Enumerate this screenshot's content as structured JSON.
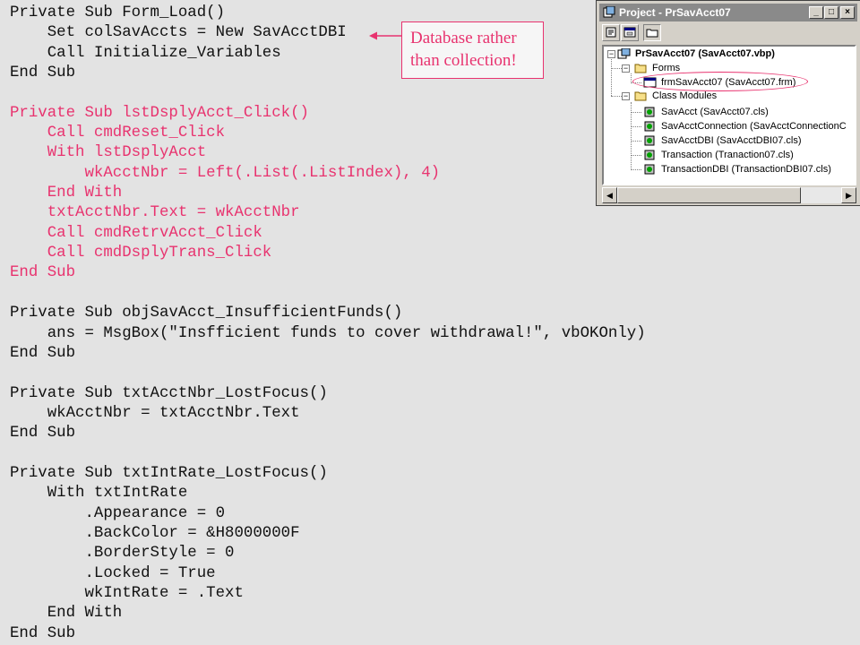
{
  "code_lines": [
    {
      "text": "Private Sub Form_Load()",
      "color": "#111111"
    },
    {
      "text": "    Set colSavAccts = New SavAcctDBI",
      "color": "#111111"
    },
    {
      "text": "    Call Initialize_Variables",
      "color": "#111111"
    },
    {
      "text": "End Sub",
      "color": "#111111"
    },
    {
      "text": "",
      "color": "#111111"
    },
    {
      "text": "Private Sub lstDsplyAcct_Click()",
      "color": "#e8336f"
    },
    {
      "text": "    Call cmdReset_Click",
      "color": "#e8336f"
    },
    {
      "text": "    With lstDsplyAcct",
      "color": "#e8336f"
    },
    {
      "text": "        wkAcctNbr = Left(.List(.ListIndex), 4)",
      "color": "#e8336f"
    },
    {
      "text": "    End With",
      "color": "#e8336f"
    },
    {
      "text": "    txtAcctNbr.Text = wkAcctNbr",
      "color": "#e8336f"
    },
    {
      "text": "    Call cmdRetrvAcct_Click",
      "color": "#e8336f"
    },
    {
      "text": "    Call cmdDsplyTrans_Click",
      "color": "#e8336f"
    },
    {
      "text": "End Sub",
      "color": "#e8336f"
    },
    {
      "text": "",
      "color": "#111111"
    },
    {
      "text": "Private Sub objSavAcct_InsufficientFunds()",
      "color": "#111111"
    },
    {
      "text": "    ans = MsgBox(\"Insfficient funds to cover withdrawal!\", vbOKOnly)",
      "color": "#111111"
    },
    {
      "text": "End Sub",
      "color": "#111111"
    },
    {
      "text": "",
      "color": "#111111"
    },
    {
      "text": "Private Sub txtAcctNbr_LostFocus()",
      "color": "#111111"
    },
    {
      "text": "    wkAcctNbr = txtAcctNbr.Text",
      "color": "#111111"
    },
    {
      "text": "End Sub",
      "color": "#111111"
    },
    {
      "text": "",
      "color": "#111111"
    },
    {
      "text": "Private Sub txtIntRate_LostFocus()",
      "color": "#111111"
    },
    {
      "text": "    With txtIntRate",
      "color": "#111111"
    },
    {
      "text": "        .Appearance = 0",
      "color": "#111111"
    },
    {
      "text": "        .BackColor = &H8000000F",
      "color": "#111111"
    },
    {
      "text": "        .BorderStyle = 0",
      "color": "#111111"
    },
    {
      "text": "        .Locked = True",
      "color": "#111111"
    },
    {
      "text": "        wkIntRate = .Text",
      "color": "#111111"
    },
    {
      "text": "    End With",
      "color": "#111111"
    },
    {
      "text": "End Sub",
      "color": "#111111"
    }
  ],
  "callout": {
    "line1": "Database rather",
    "line2": "than collection!"
  },
  "accent_color": "#e8336f",
  "project_window": {
    "title": "Project - PrSavAcct07",
    "title_buttons": [
      "_",
      "□",
      "×"
    ],
    "toolbar": [
      "view-code-icon",
      "view-object-icon",
      "toggle-folders-icon"
    ],
    "root": "PrSavAcct07 (SavAcct07.vbp)",
    "forms_folder": "Forms",
    "forms": [
      "frmSavAcct07 (SavAcct07.frm)"
    ],
    "class_folder": "Class Modules",
    "classes": [
      "SavAcct (SavAcct07.cls)",
      "SavAcctConnection (SavAcctConnectionC",
      "SavAcctDBI (SavAcctDBI07.cls)",
      "Transaction (Tranaction07.cls)",
      "TransactionDBI (TransactionDBI07.cls)"
    ]
  }
}
